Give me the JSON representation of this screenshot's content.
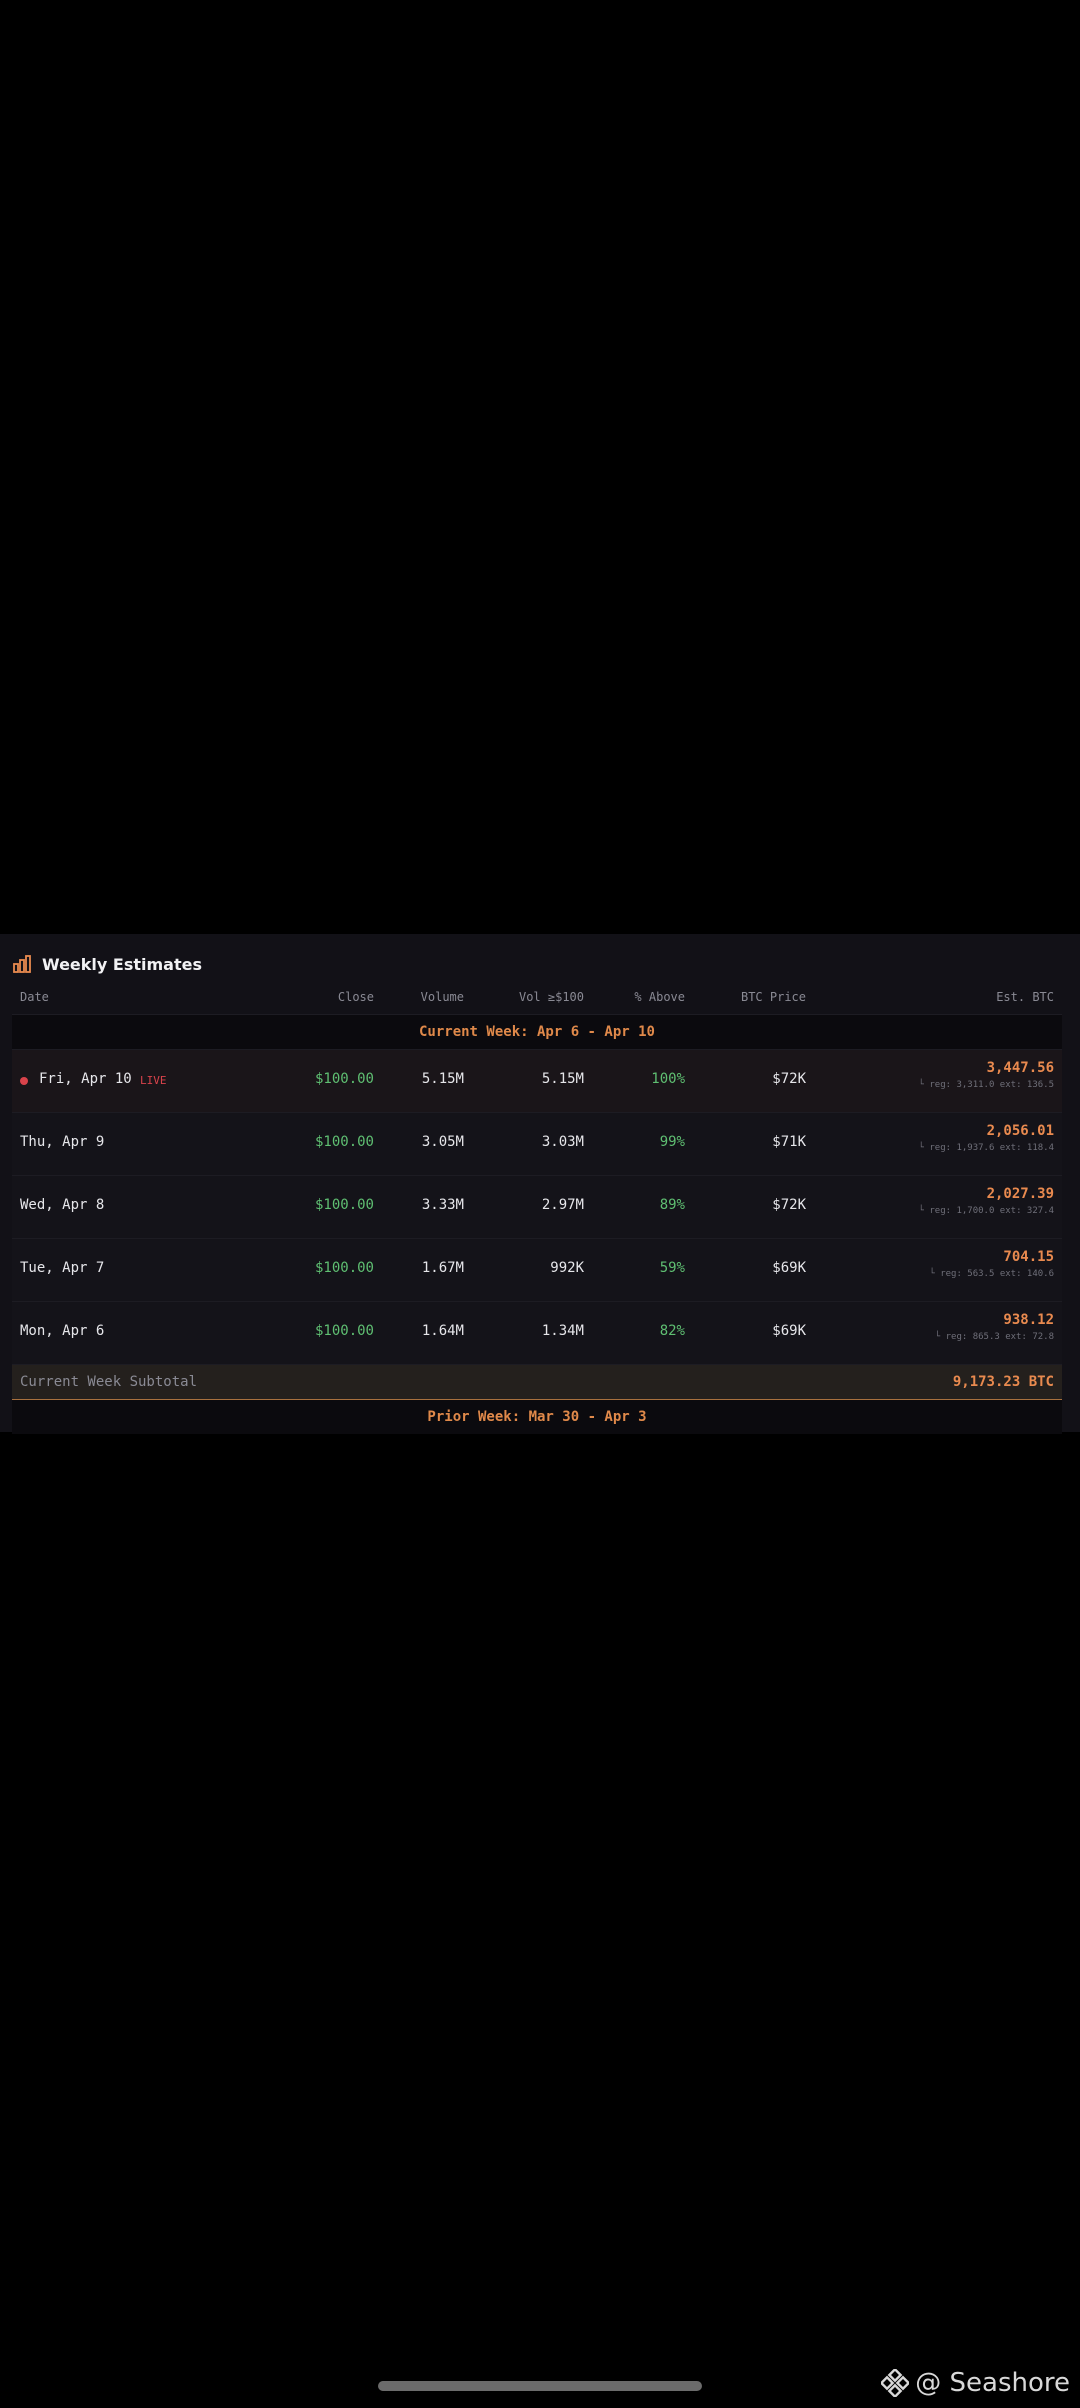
{
  "panel": {
    "title": "Weekly Estimates",
    "icon": "bar-chart-icon"
  },
  "columns": {
    "date": "Date",
    "close": "Close",
    "volume": "Volume",
    "vol100": "Vol ≥$100",
    "above": "% Above",
    "btc_price": "BTC Price",
    "est_btc": "Est. BTC"
  },
  "current_week": {
    "label": "Current Week: Apr 6 - Apr 10",
    "rows": [
      {
        "date": "Fri, Apr 10",
        "live": "LIVE",
        "close": "$100.00",
        "volume": "5.15M",
        "vol100": "5.15M",
        "above": "100%",
        "btc_price": "$72K",
        "est": "3,447.56",
        "est_sub": "└ reg: 3,311.0 ext: 136.5"
      },
      {
        "date": "Thu, Apr 9",
        "close": "$100.00",
        "volume": "3.05M",
        "vol100": "3.03M",
        "above": "99%",
        "btc_price": "$71K",
        "est": "2,056.01",
        "est_sub": "└ reg: 1,937.6 ext: 118.4"
      },
      {
        "date": "Wed, Apr 8",
        "close": "$100.00",
        "volume": "3.33M",
        "vol100": "2.97M",
        "above": "89%",
        "btc_price": "$72K",
        "est": "2,027.39",
        "est_sub": "└ reg: 1,700.0 ext: 327.4"
      },
      {
        "date": "Tue, Apr 7",
        "close": "$100.00",
        "volume": "1.67M",
        "vol100": "992K",
        "above": "59%",
        "btc_price": "$69K",
        "est": "704.15",
        "est_sub": "└ reg: 563.5 ext: 140.6"
      },
      {
        "date": "Mon, Apr 6",
        "close": "$100.00",
        "volume": "1.64M",
        "vol100": "1.34M",
        "above": "82%",
        "btc_price": "$69K",
        "est": "938.12",
        "est_sub": "└ reg: 865.3 ext: 72.8"
      }
    ],
    "subtotal_label": "Current Week Subtotal",
    "subtotal_value": "9,173.23 BTC"
  },
  "prior_week": {
    "label": "Prior Week: Mar 30 - Apr 3"
  },
  "watermark": {
    "text": "@ Seashore",
    "icon": "diamond-logo-icon"
  },
  "colors": {
    "accent": "#e98a4f",
    "positive": "#5fbf72",
    "live": "#d9434b"
  }
}
